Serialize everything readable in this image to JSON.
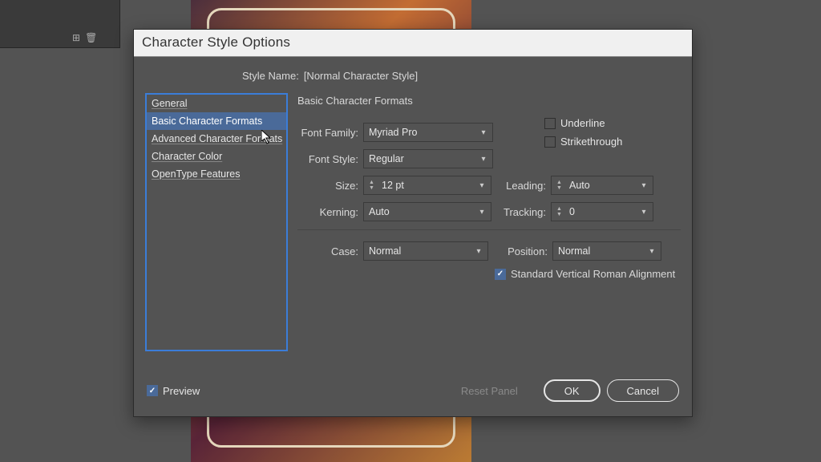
{
  "bg_panel": {
    "tab": ""
  },
  "dialog": {
    "title": "Character Style Options",
    "style_name_label": "Style Name:",
    "style_name_value": "[Normal Character Style]",
    "categories": [
      "General",
      "Basic Character Formats",
      "Advanced Character Formats",
      "Character Color",
      "OpenType Features"
    ],
    "selected_category_index": 1,
    "section_title": "Basic Character Formats",
    "fields": {
      "font_family": {
        "label": "Font Family:",
        "value": "Myriad Pro"
      },
      "font_style": {
        "label": "Font Style:",
        "value": "Regular"
      },
      "size": {
        "label": "Size:",
        "value": "12 pt"
      },
      "leading": {
        "label": "Leading:",
        "value": "Auto"
      },
      "kerning": {
        "label": "Kerning:",
        "value": "Auto"
      },
      "tracking": {
        "label": "Tracking:",
        "value": "0"
      },
      "case": {
        "label": "Case:",
        "value": "Normal"
      },
      "position": {
        "label": "Position:",
        "value": "Normal"
      }
    },
    "checks": {
      "underline": {
        "label": "Underline",
        "checked": false
      },
      "strikethrough": {
        "label": "Strikethrough",
        "checked": false
      },
      "svra": {
        "label": "Standard Vertical Roman Alignment",
        "checked": true
      }
    },
    "footer": {
      "preview_label": "Preview",
      "preview_checked": true,
      "reset_label": "Reset Panel",
      "ok_label": "OK",
      "cancel_label": "Cancel"
    }
  }
}
